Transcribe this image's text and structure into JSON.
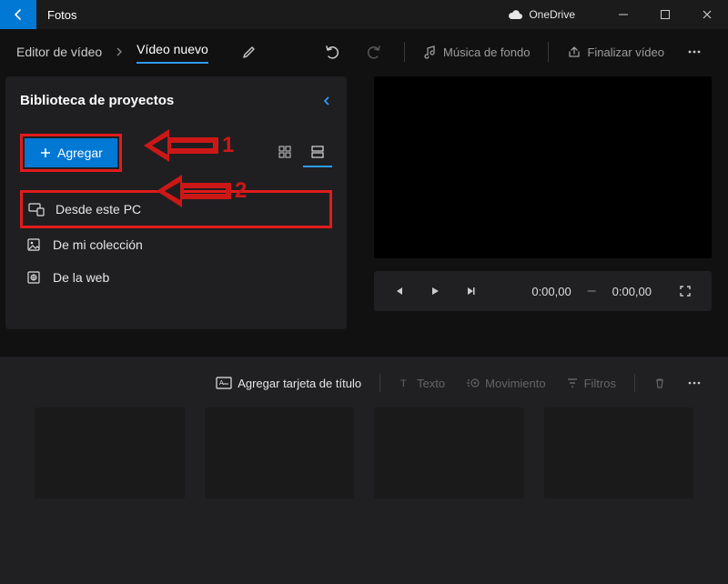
{
  "titlebar": {
    "app_name": "Fotos",
    "onedrive": "OneDrive"
  },
  "breadcrumb": {
    "root": "Editor de vídeo",
    "current": "Vídeo nuevo"
  },
  "toolbar": {
    "bg_music": "Música de fondo",
    "finalize": "Finalizar vídeo"
  },
  "library": {
    "title": "Biblioteca de proyectos",
    "add_label": "Agregar",
    "menu": {
      "from_pc": "Desde este PC",
      "from_collection": "De mi colección",
      "from_web": "De la web"
    }
  },
  "annotations": {
    "num1": "1",
    "num2": "2"
  },
  "player": {
    "current_time": "0:00,00",
    "total_time": "0:00,00"
  },
  "storyboard": {
    "add_title_card": "Agregar tarjeta de título",
    "text": "Texto",
    "motion": "Movimiento",
    "filters": "Filtros"
  }
}
